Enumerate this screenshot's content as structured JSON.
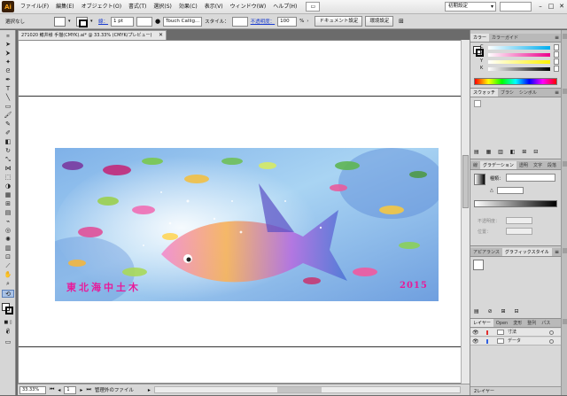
{
  "app": {
    "logo": "Ai"
  },
  "menu": {
    "items": [
      "ファイル(F)",
      "編集(E)",
      "オブジェクト(O)",
      "書式(T)",
      "選択(S)",
      "効果(C)",
      "表示(V)",
      "ウィンドウ(W)",
      "ヘルプ(H)"
    ],
    "workspace": "初期設定",
    "window_buttons": [
      "–",
      "□",
      "✕"
    ]
  },
  "control": {
    "selection": "選択なし",
    "stroke_label": "線：",
    "stroke_weight": "1 pt",
    "brush": "Touch Callig...",
    "style_label": "スタイル：",
    "opacity_label": "不透明度：",
    "opacity_value": "100",
    "opacity_unit": "%",
    "doc_settings": "ドキュメント設定",
    "prefs": "環境設定"
  },
  "document": {
    "tab_title": "271020 鰭井様 手描(CMYK).ai* @ 33.33% (CMYK/プレビュー)",
    "close": "✕"
  },
  "artwork": {
    "title": "東北海中土木",
    "year": "2015"
  },
  "status": {
    "zoom": "33.33%",
    "page": "1",
    "info": "管理外のファイル"
  },
  "panels": {
    "color": {
      "tabs": [
        "カラー",
        "カラーガイド"
      ],
      "channels": [
        "C",
        "M",
        "Y",
        "K"
      ]
    },
    "swatches": {
      "tabs": [
        "スウォッチ",
        "ブラシ",
        "シンボル"
      ]
    },
    "gradient": {
      "tabs": [
        "線",
        "グラデーション",
        "透明",
        "文字",
        "段落",
        "OT"
      ],
      "type_label": "種類："
    },
    "gradient_fields": {
      "angle_label": "△",
      "opacity_label": "不透明度：",
      "location_label": "位置："
    },
    "appearance": {
      "tabs": [
        "アピアランス",
        "グラフィックスタイル"
      ]
    },
    "layers": {
      "tabs": [
        "レイヤー",
        "Open",
        "変形",
        "整列",
        "パス"
      ],
      "rows": [
        {
          "name": "寸法",
          "color": "#e03030"
        },
        {
          "name": "データ",
          "color": "#3060e0"
        }
      ],
      "count": "2レイヤー"
    }
  },
  "colors": {
    "accent_pink": "#e8199a",
    "ai_orange": "#f7a21b"
  }
}
